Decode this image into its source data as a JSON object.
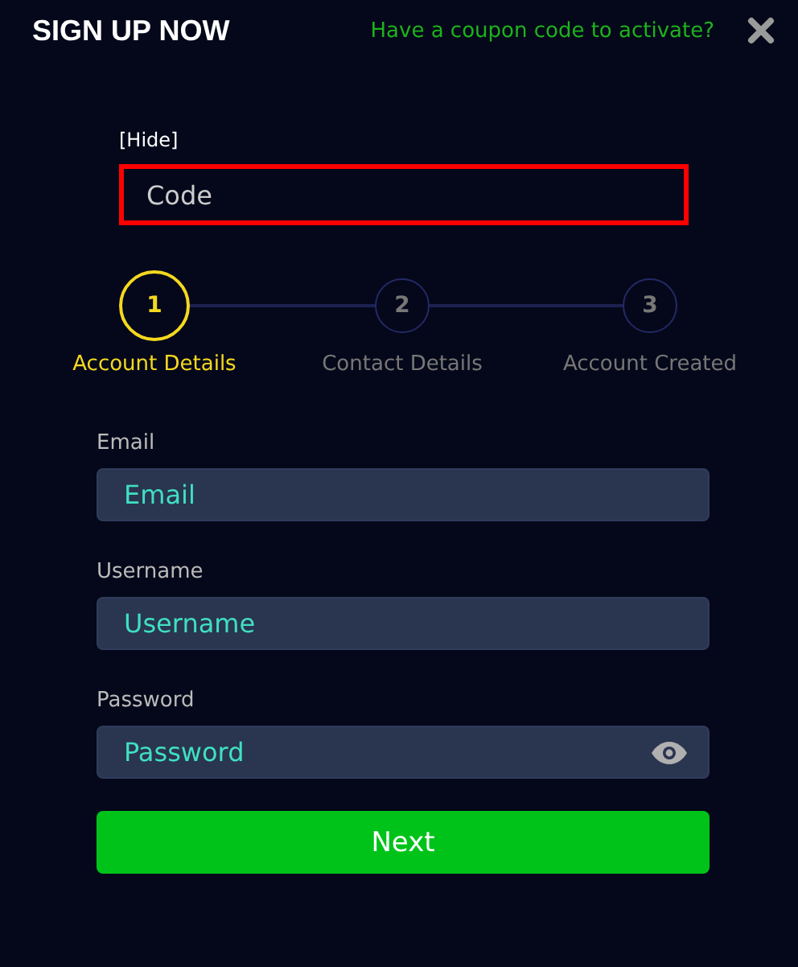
{
  "header": {
    "title": "SIGN UP NOW",
    "coupon_link": "Have a coupon code to activate?"
  },
  "coupon": {
    "toggle": "[Hide]",
    "placeholder": "Code"
  },
  "steps": [
    {
      "number": "1",
      "label": "Account Details",
      "selected": true
    },
    {
      "number": "2",
      "label": "Contact Details",
      "selected": false
    },
    {
      "number": "3",
      "label": "Account Created",
      "selected": false
    }
  ],
  "fields": [
    {
      "kind": "text",
      "label": "Email",
      "placeholder": "Email"
    },
    {
      "kind": "text",
      "label": "Username",
      "placeholder": "Username"
    },
    {
      "kind": "password",
      "label": "Password",
      "placeholder": "Password"
    }
  ],
  "buttons": [
    "Next"
  ]
}
